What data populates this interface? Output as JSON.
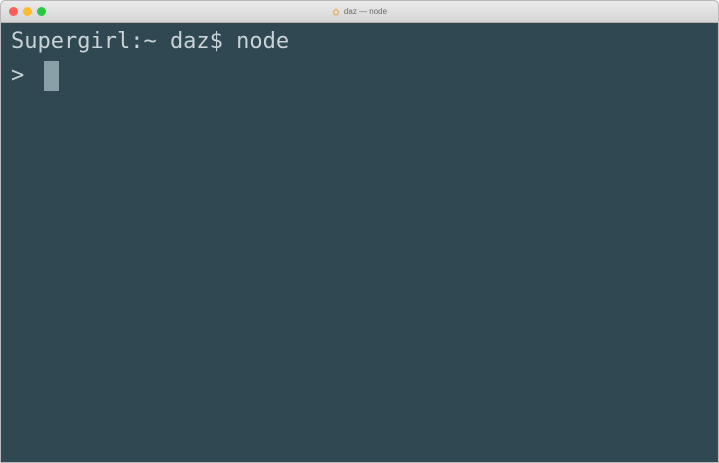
{
  "window": {
    "title": "daz — node",
    "title_icon": "home-icon",
    "colors": {
      "terminal_bg": "#2f4852",
      "terminal_fg": "#c9d2d6",
      "cursor": "#8aa0a8",
      "close": "#fc5f57",
      "minimize": "#fdbc2e",
      "zoom": "#28c840"
    }
  },
  "terminal": {
    "lines": [
      "Supergirl:~ daz$ node"
    ],
    "prompt": ">"
  }
}
